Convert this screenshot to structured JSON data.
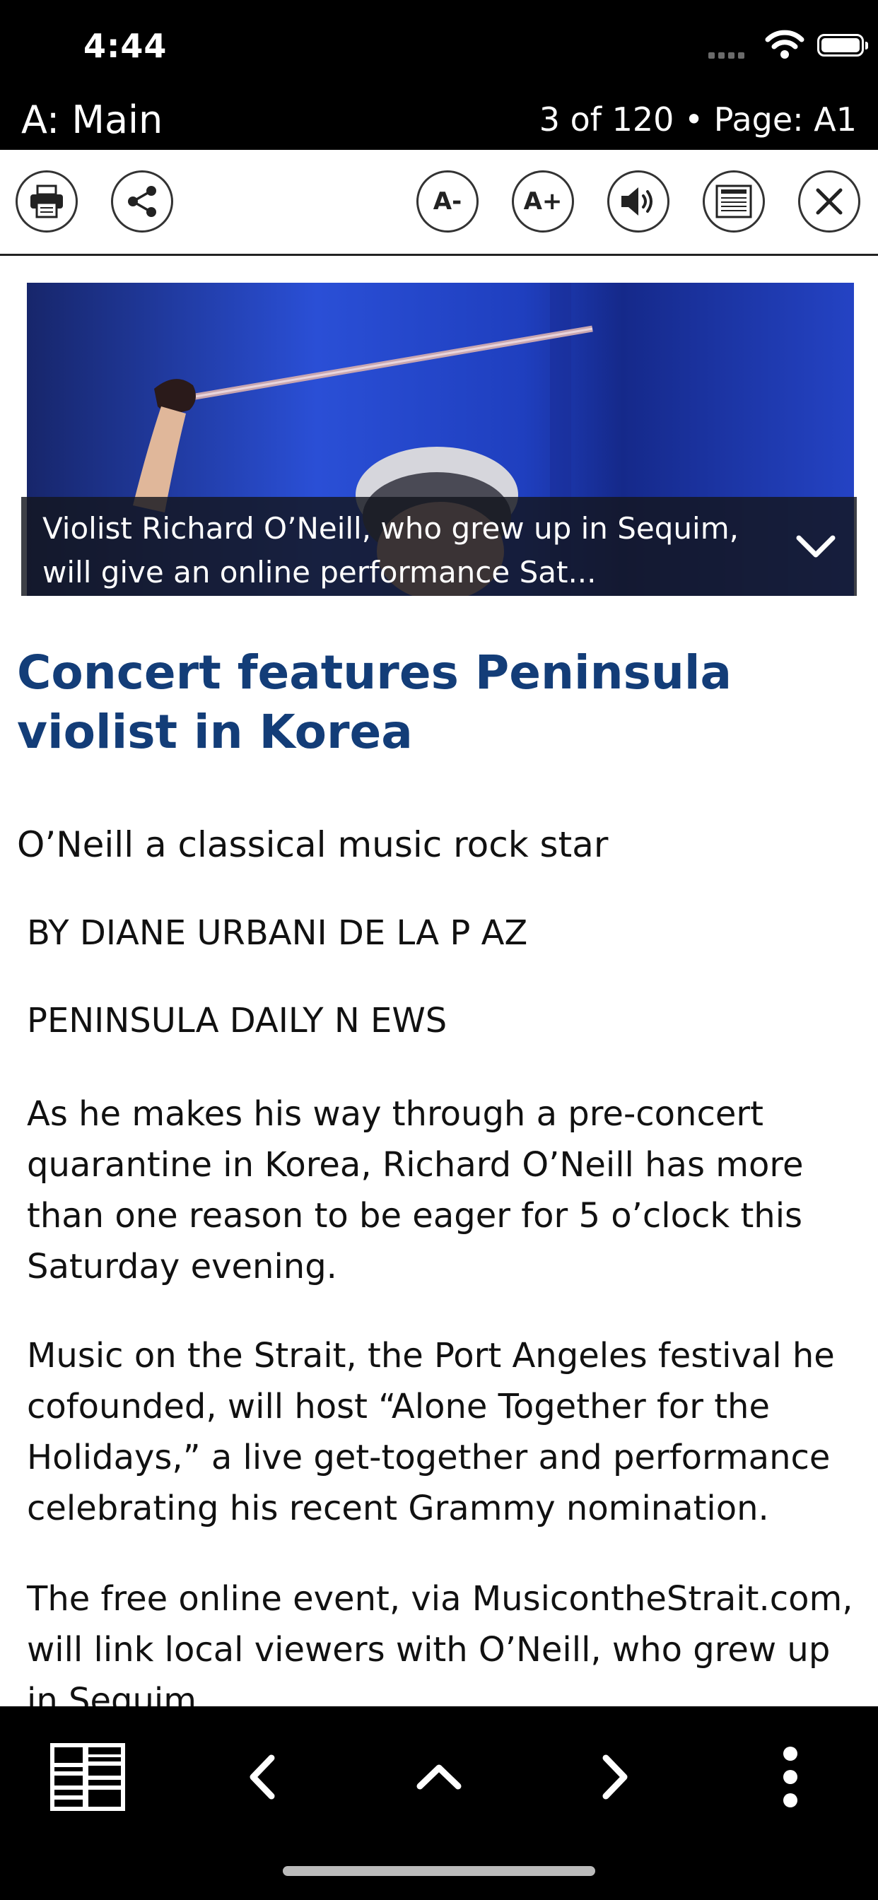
{
  "status_bar": {
    "time": "4:44",
    "signal": "signal-icon",
    "wifi": "wifi-icon",
    "battery": "battery-icon"
  },
  "header": {
    "section": "A: Main",
    "position": "3 of 120 • Page: A1"
  },
  "toolbar": {
    "print": "print-icon",
    "share": "share-icon",
    "font_decrease_label": "A-",
    "font_increase_label": "A+",
    "audio": "speaker-icon",
    "page_view": "newspaper-icon",
    "close": "close-icon"
  },
  "photo": {
    "caption": "Violist Richard O’Neill, who grew up in Sequim, will give an online performance Sat...",
    "expand_icon": "chevron-down-icon"
  },
  "article": {
    "headline": "Concert features Peninsula violist in Korea",
    "subheadline": "O’Neill a classical music rock star",
    "byline": "BY DIANE URBANI DE LA P AZ",
    "organization": "PENINSULA DAILY N EWS",
    "paragraphs": [
      "As he makes his way through a pre-concert quarantine in Korea, Richard O’Neill has more than one reason to be eager for 5 o’clock this Saturday evening.",
      "Music on the Strait, the Port Angeles festival he cofounded, will host “Alone Together for the Holidays,” a live get-together and performance celebrating his recent Grammy nomination.",
      "The free online event, via MusicontheStrait.com, will link local viewers with O’Neill, who grew up in Sequim."
    ]
  },
  "bottom_bar": {
    "sections": "newspaper-sections-icon",
    "previous": "chevron-left-icon",
    "up": "chevron-up-icon",
    "next": "chevron-right-icon",
    "more": "more-vertical-icon"
  },
  "colors": {
    "headline": "#133d78",
    "bars": "#000000",
    "photo_background": "#1d3fb8"
  }
}
